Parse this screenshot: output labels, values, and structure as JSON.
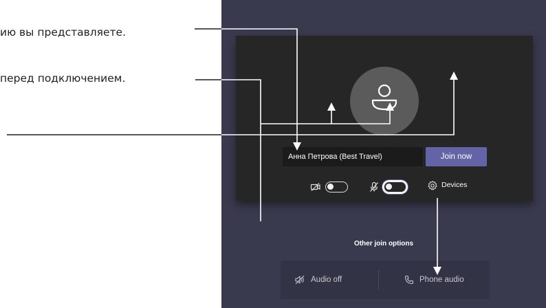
{
  "callouts": [
    "ию вы представляете.",
    "перед подключением."
  ],
  "prejoin": {
    "name_value": "Анна Петрова (Best Travel)",
    "join_label": "Join now",
    "video_icon": "video-off-icon",
    "mic_icon": "mic-off-icon",
    "video_toggle_on": false,
    "mic_toggle_on": false,
    "devices_icon": "gear-icon",
    "devices_label": "Devices"
  },
  "other_options": {
    "title": "Other join options",
    "items": [
      {
        "icon": "speaker-off-icon",
        "label": "Audio off"
      },
      {
        "icon": "phone-icon",
        "label": "Phone audio"
      }
    ]
  },
  "colors": {
    "app_bg": "#3a3a4e",
    "preview_bg": "#262626",
    "accent": "#6264a7",
    "annotation_line": "#ffffff"
  }
}
